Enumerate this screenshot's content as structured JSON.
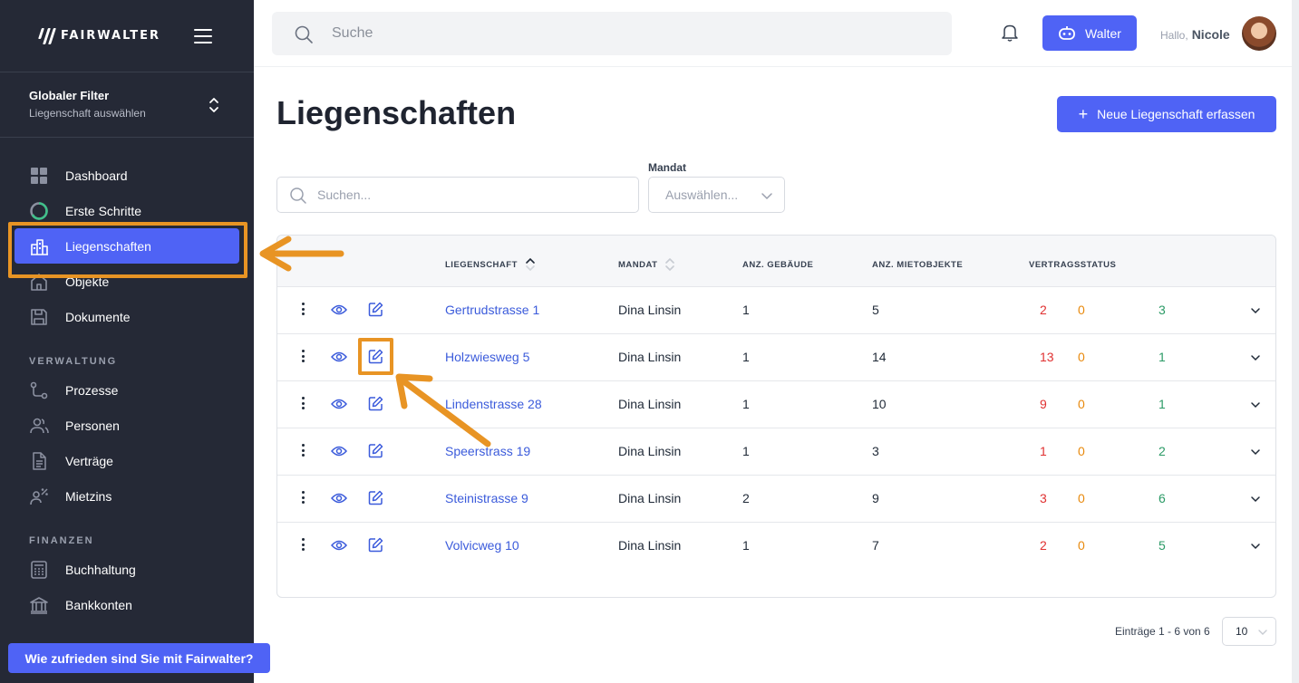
{
  "sidebar": {
    "logo_text": "FAIRWALTER",
    "global_filter": {
      "title": "Globaler Filter",
      "subtitle": "Liegenschaft auswählen"
    },
    "items_main": [
      {
        "label": "Dashboard",
        "icon": "grid-icon"
      },
      {
        "label": "Erste Schritte",
        "icon": "progress-ring-icon"
      },
      {
        "label": "Liegenschaften",
        "icon": "buildings-icon",
        "active": true
      },
      {
        "label": "Objekte",
        "icon": "home-icon"
      },
      {
        "label": "Dokumente",
        "icon": "save-icon"
      }
    ],
    "section_verwaltung": "VERWALTUNG",
    "items_verwaltung": [
      {
        "label": "Prozesse",
        "icon": "process-icon"
      },
      {
        "label": "Personen",
        "icon": "users-icon"
      },
      {
        "label": "Verträge",
        "icon": "document-icon"
      },
      {
        "label": "Mietzins",
        "icon": "percent-person-icon"
      }
    ],
    "section_finanzen": "FINANZEN",
    "items_finanzen": [
      {
        "label": "Buchhaltung",
        "icon": "calculator-icon"
      },
      {
        "label": "Bankkonten",
        "icon": "bank-icon"
      }
    ],
    "feedback_label": "Wie zufrieden sind Sie mit Fairwalter?"
  },
  "topbar": {
    "search_placeholder": "Suche",
    "walter_label": "Walter",
    "greeting": "Hallo,",
    "user_name": "Nicole"
  },
  "main": {
    "title": "Liegenschaften",
    "new_button": "Neue Liegenschaft erfassen",
    "search_placeholder": "Suchen...",
    "mandat_label": "Mandat",
    "mandat_placeholder": "Auswählen...",
    "columns": {
      "liegenschaft": "LIEGENSCHAFT",
      "mandat": "MANDAT",
      "gebaeude": "ANZ. GEBÄUDE",
      "mietobjekte": "ANZ. MIETOBJEKTE",
      "vertragsstatus": "VERTRAGSSTATUS"
    },
    "rows": [
      {
        "name": "Gertrudstrasse 1",
        "mandat": "Dina Linsin",
        "gebaeude": "1",
        "mietobjekte": "5",
        "red": "2",
        "orange": "0",
        "green": "3"
      },
      {
        "name": "Holzwiesweg 5",
        "mandat": "Dina Linsin",
        "gebaeude": "1",
        "mietobjekte": "14",
        "red": "13",
        "orange": "0",
        "green": "1"
      },
      {
        "name": "Lindenstrasse 28",
        "mandat": "Dina Linsin",
        "gebaeude": "1",
        "mietobjekte": "10",
        "red": "9",
        "orange": "0",
        "green": "1"
      },
      {
        "name": "Speerstrass 19",
        "mandat": "Dina Linsin",
        "gebaeude": "1",
        "mietobjekte": "3",
        "red": "1",
        "orange": "0",
        "green": "2"
      },
      {
        "name": "Steinistrasse 9",
        "mandat": "Dina Linsin",
        "gebaeude": "2",
        "mietobjekte": "9",
        "red": "3",
        "orange": "0",
        "green": "6"
      },
      {
        "name": "Volvicweg 10",
        "mandat": "Dina Linsin",
        "gebaeude": "1",
        "mietobjekte": "7",
        "red": "2",
        "orange": "0",
        "green": "5"
      }
    ],
    "pager_text": "Einträge 1 - 6 von 6",
    "page_size": "10"
  },
  "colors": {
    "sidebar_bg": "#252936",
    "accent": "#4f63f5",
    "highlight": "#e89424",
    "status_red": "#e03131",
    "status_orange": "#e8890c",
    "status_green": "#2b9a66"
  }
}
